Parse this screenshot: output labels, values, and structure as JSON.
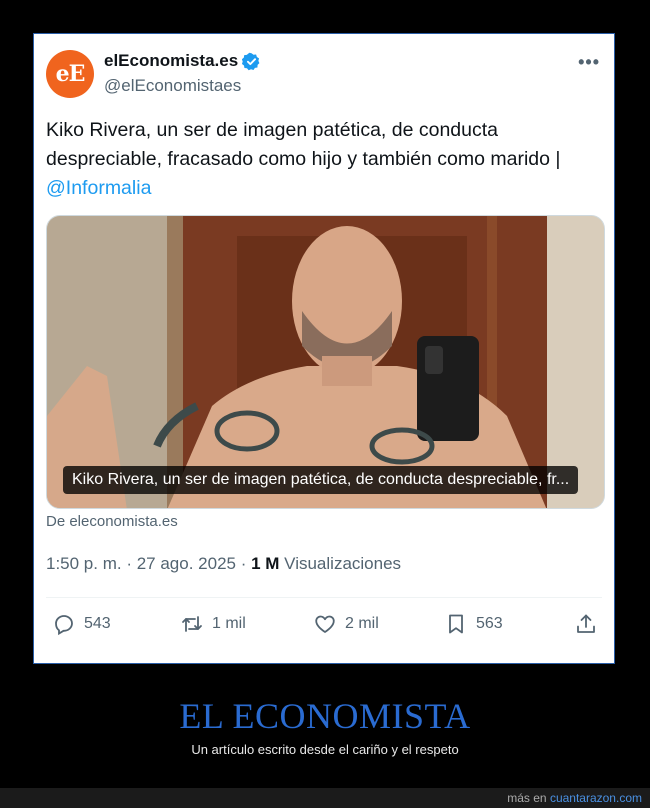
{
  "tweet": {
    "avatar_text": "eE",
    "account_name": "elEconomista.es",
    "handle": "@elEconomistaes",
    "more_label": "•••",
    "text": "Kiko Rivera, un ser de imagen patética, de conducta despreciable, fracasado como hijo y también como marido | ",
    "mention": "@Informalia",
    "media_caption": "Kiko Rivera, un ser de imagen patética, de conducta despreciable, fr...",
    "source": "De eleconomista.es",
    "time": "1:50 p. m.",
    "date": "27 ago. 2025",
    "views_count": "1 M",
    "views_label": "Visualizaciones",
    "replies": "543",
    "retweets": "1 mil",
    "likes": "2 mil",
    "bookmarks": "563"
  },
  "footer": {
    "title": "EL ECONOMISTA",
    "subtitle": "Un artículo escrito desde el cariño y el respeto",
    "site_prefix": "más en",
    "site_name": "cuantarazon.com"
  },
  "colors": {
    "link": "#1d9bf0",
    "brand_orange": "#f0641e",
    "footer_title": "#2a6bd1"
  }
}
